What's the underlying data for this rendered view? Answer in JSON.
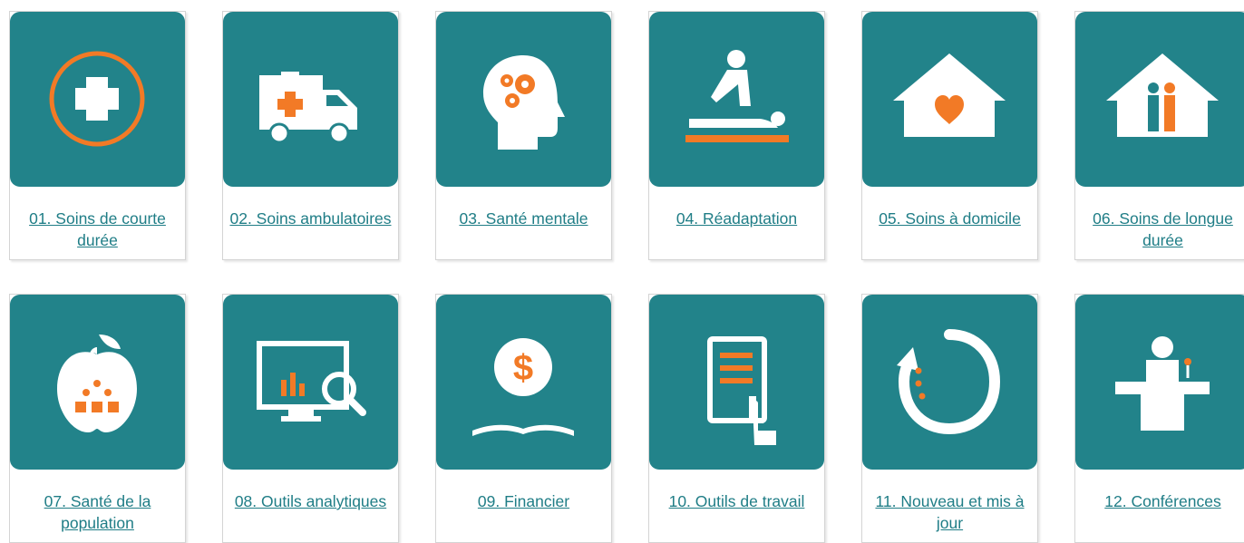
{
  "colors": {
    "teal": "#22838a",
    "orange": "#f27a26",
    "white": "#ffffff",
    "link": "#1f7d86"
  },
  "cards": [
    {
      "label": "01. Soins de courte durée",
      "icon": "medical-cross-icon"
    },
    {
      "label": "02. Soins ambulatoires",
      "icon": "ambulance-icon"
    },
    {
      "label": "03. Santé mentale",
      "icon": "head-gears-icon"
    },
    {
      "label": "04. Réadaptation",
      "icon": "massage-therapy-icon"
    },
    {
      "label": "05. Soins à domicile",
      "icon": "house-heart-icon"
    },
    {
      "label": "06. Soins de longue durée",
      "icon": "house-people-icon"
    },
    {
      "label": "07. Santé de la population",
      "icon": "apple-people-icon"
    },
    {
      "label": "08. Outils analytiques",
      "icon": "monitor-magnifier-icon"
    },
    {
      "label": "09. Financier",
      "icon": "dollar-book-icon"
    },
    {
      "label": "10. Outils de travail",
      "icon": "tablet-document-icon"
    },
    {
      "label": "11. Nouveau et mis à jour",
      "icon": "refresh-arrow-icon"
    },
    {
      "label": "12. Conférences",
      "icon": "speaker-podium-icon"
    }
  ]
}
